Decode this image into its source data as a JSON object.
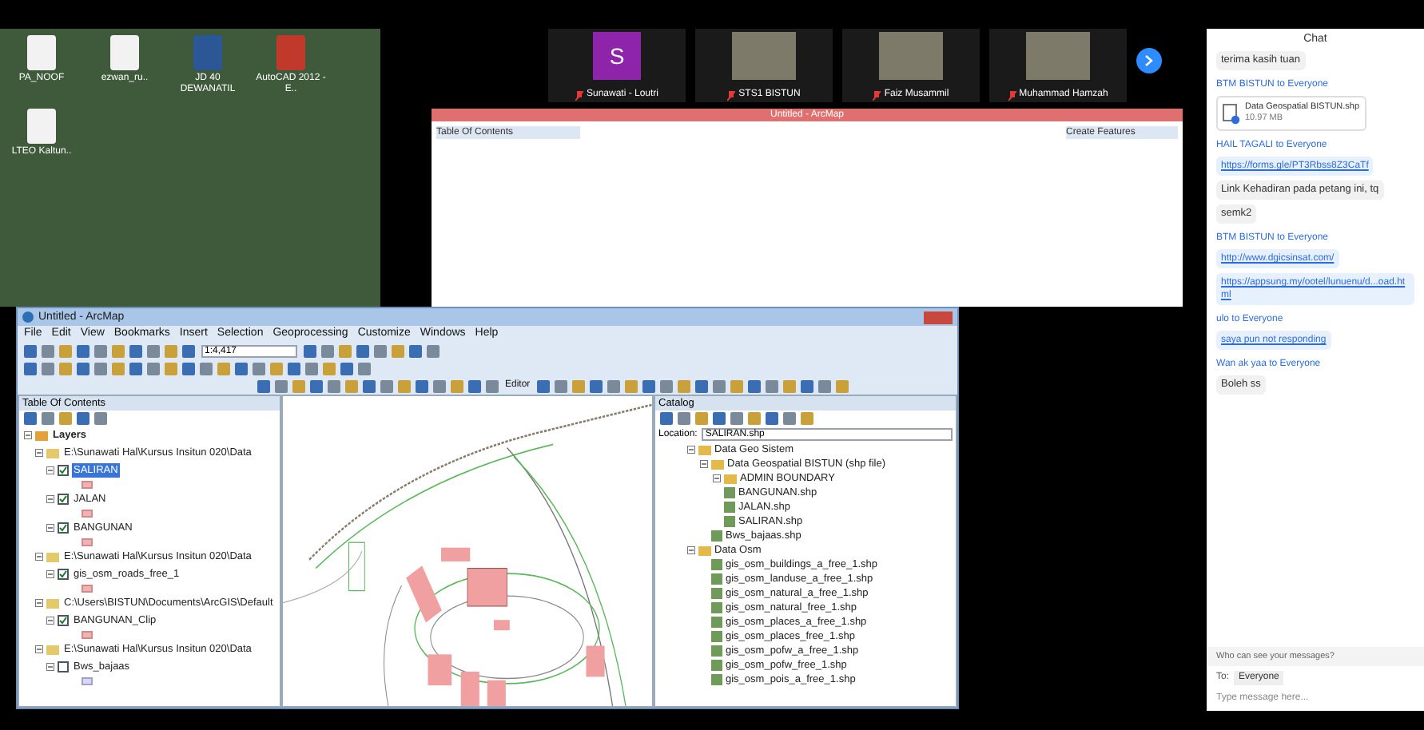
{
  "desktop": {
    "icons": [
      {
        "label": "PA_NOOF",
        "kind": "file"
      },
      {
        "label": "ezwan_ru..",
        "kind": "file"
      },
      {
        "label": "JD 40 DEWANATIL",
        "kind": "word"
      },
      {
        "label": "AutoCAD 2012 - E..",
        "kind": "pdf"
      },
      {
        "label": "LTEO Kaltun..",
        "kind": "file"
      }
    ]
  },
  "gallery": {
    "participants": [
      {
        "name": "Sunawati - Loutri",
        "kind": "avatar",
        "initial": "S"
      },
      {
        "name": "STS1 BISTUN",
        "kind": "video"
      },
      {
        "name": "Faiz Musammil",
        "kind": "video"
      },
      {
        "name": "Muhammad Hamzah",
        "kind": "video"
      }
    ]
  },
  "back_window": {
    "title": "Untitled - ArcMap",
    "panels": [
      "Table Of Contents",
      "Create Features"
    ]
  },
  "arcmap": {
    "title": "Untitled - ArcMap",
    "menu": [
      "File",
      "Edit",
      "View",
      "Bookmarks",
      "Insert",
      "Selection",
      "Geoprocessing",
      "Customize",
      "Windows",
      "Help"
    ],
    "scale": "1:4,417",
    "editor": "Editor",
    "toc": {
      "title": "Table Of Contents",
      "layers": [
        {
          "label": "Layers",
          "kind": "root",
          "expanded": true,
          "children": [
            {
              "label": "E:\\Sunawati Hal\\Kursus Insitun 020\\Data",
              "kind": "group",
              "expanded": true,
              "children": [
                {
                  "label": "SALIRAN",
                  "kind": "layer",
                  "checked": true,
                  "selected": true
                },
                {
                  "label": "JALAN",
                  "kind": "layer",
                  "checked": true,
                  "selected": false
                },
                {
                  "label": "BANGUNAN",
                  "kind": "layer",
                  "checked": true,
                  "selected": false
                }
              ]
            },
            {
              "label": "E:\\Sunawati Hal\\Kursus Insitun 020\\Data",
              "kind": "group",
              "expanded": true,
              "children": [
                {
                  "label": "gis_osm_roads_free_1",
                  "kind": "layer",
                  "checked": true,
                  "selected": false
                }
              ]
            },
            {
              "label": "C:\\Users\\BISTUN\\Documents\\ArcGIS\\Default",
              "kind": "group",
              "expanded": true,
              "children": [
                {
                  "label": "BANGUNAN_Clip",
                  "kind": "layer",
                  "checked": true,
                  "selected": false
                }
              ]
            },
            {
              "label": "E:\\Sunawati Hal\\Kursus Insitun 020\\Data",
              "kind": "group",
              "expanded": true,
              "children": [
                {
                  "label": "Bws_bajaas",
                  "kind": "layer",
                  "checked": false,
                  "selected": false
                }
              ]
            }
          ]
        }
      ]
    },
    "catalog": {
      "title": "Catalog",
      "location_label": "Location:",
      "location": "SALIRAN.shp",
      "tree": [
        {
          "label": "Data Geo Sistem",
          "kind": "folder",
          "expanded": true,
          "children": [
            {
              "label": "Data Geospatial BISTUN (shp file)",
              "kind": "folder",
              "expanded": true,
              "children": [
                {
                  "label": "ADMIN BOUNDARY",
                  "kind": "folder",
                  "expanded": true
                },
                {
                  "label": "BANGUNAN.shp",
                  "kind": "file"
                },
                {
                  "label": "JALAN.shp",
                  "kind": "file"
                },
                {
                  "label": "SALIRAN.shp",
                  "kind": "file"
                }
              ]
            },
            {
              "label": "Bws_bajaas.shp",
              "kind": "file"
            }
          ]
        },
        {
          "label": "Data Osm",
          "kind": "folder",
          "expanded": true,
          "children": [
            {
              "label": "gis_osm_buildings_a_free_1.shp",
              "kind": "file"
            },
            {
              "label": "gis_osm_landuse_a_free_1.shp",
              "kind": "file"
            },
            {
              "label": "gis_osm_natural_a_free_1.shp",
              "kind": "file"
            },
            {
              "label": "gis_osm_natural_free_1.shp",
              "kind": "file"
            },
            {
              "label": "gis_osm_places_a_free_1.shp",
              "kind": "file"
            },
            {
              "label": "gis_osm_places_free_1.shp",
              "kind": "file"
            },
            {
              "label": "gis_osm_pofw_a_free_1.shp",
              "kind": "file"
            },
            {
              "label": "gis_osm_pofw_free_1.shp",
              "kind": "file"
            },
            {
              "label": "gis_osm_pois_a_free_1.shp",
              "kind": "file"
            }
          ]
        }
      ]
    }
  },
  "chat": {
    "title": "Chat",
    "messages": [
      {
        "kind": "bubble",
        "text": "terima kasih tuan"
      },
      {
        "kind": "sender",
        "text": "BTM BISTUN to Everyone"
      },
      {
        "kind": "file",
        "text": "Data Geospatial BISTUN.shp",
        "size": "10.97 MB"
      },
      {
        "kind": "sender",
        "text": "HAIL TAGALI to Everyone"
      },
      {
        "kind": "link",
        "text": "https://forms.gle/PT3Rbss8Z3CaTf"
      },
      {
        "kind": "bubble",
        "text": "Link Kehadiran pada petang ini, tq"
      },
      {
        "kind": "bubble",
        "text": "semk2"
      },
      {
        "kind": "sender",
        "text": "BTM BISTUN to Everyone"
      },
      {
        "kind": "link",
        "text": "http://www.dgicsinsat.com/"
      },
      {
        "kind": "link",
        "text": "https://appsung.my/ootel/lunuenu/d...oad.html"
      },
      {
        "kind": "sender",
        "text": "ulo to Everyone"
      },
      {
        "kind": "link",
        "text": "saya pun not responding"
      },
      {
        "kind": "sender",
        "text": "Wan ak yaa to Everyone"
      },
      {
        "kind": "bubble",
        "text": "Boleh ss"
      }
    ],
    "notice": "Who can see your messages?",
    "to_label": "To:",
    "recipient": "Everyone",
    "placeholder": "Type message here..."
  }
}
